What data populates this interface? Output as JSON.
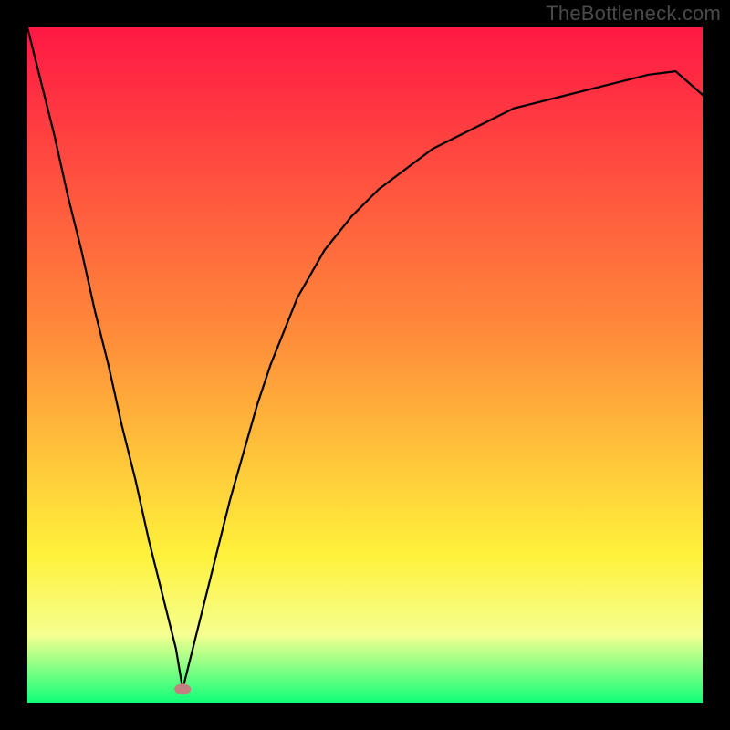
{
  "watermark": "TheBottleneck.com",
  "chart_data": {
    "type": "line",
    "title": "",
    "xlabel": "",
    "ylabel": "",
    "xlim": [
      0,
      100
    ],
    "ylim": [
      0,
      100
    ],
    "grid": false,
    "annotations": [],
    "marker": {
      "x": 23,
      "y": 2,
      "color": "#c28080"
    },
    "background_gradient": {
      "top": "#ff1844",
      "mid1": "#ff8a3a",
      "mid2": "#fff13a",
      "band": "#f5ff90",
      "bottom": "#10ff78"
    },
    "series": [
      {
        "name": "curve",
        "color": "#000000",
        "x": [
          0,
          2,
          4,
          6,
          8,
          10,
          12,
          14,
          16,
          18,
          20,
          22,
          23,
          24,
          26,
          28,
          30,
          32,
          34,
          36,
          38,
          40,
          44,
          48,
          52,
          56,
          60,
          64,
          68,
          72,
          76,
          80,
          84,
          88,
          92,
          96,
          100
        ],
        "y": [
          100,
          92,
          84,
          75,
          67,
          58,
          50,
          41,
          33,
          24,
          16,
          8,
          2,
          6,
          14,
          22,
          30,
          37,
          44,
          50,
          55,
          60,
          67,
          72,
          76,
          79,
          82,
          84,
          86,
          88,
          89,
          90,
          91,
          92,
          93,
          93.5,
          90
        ]
      }
    ]
  }
}
